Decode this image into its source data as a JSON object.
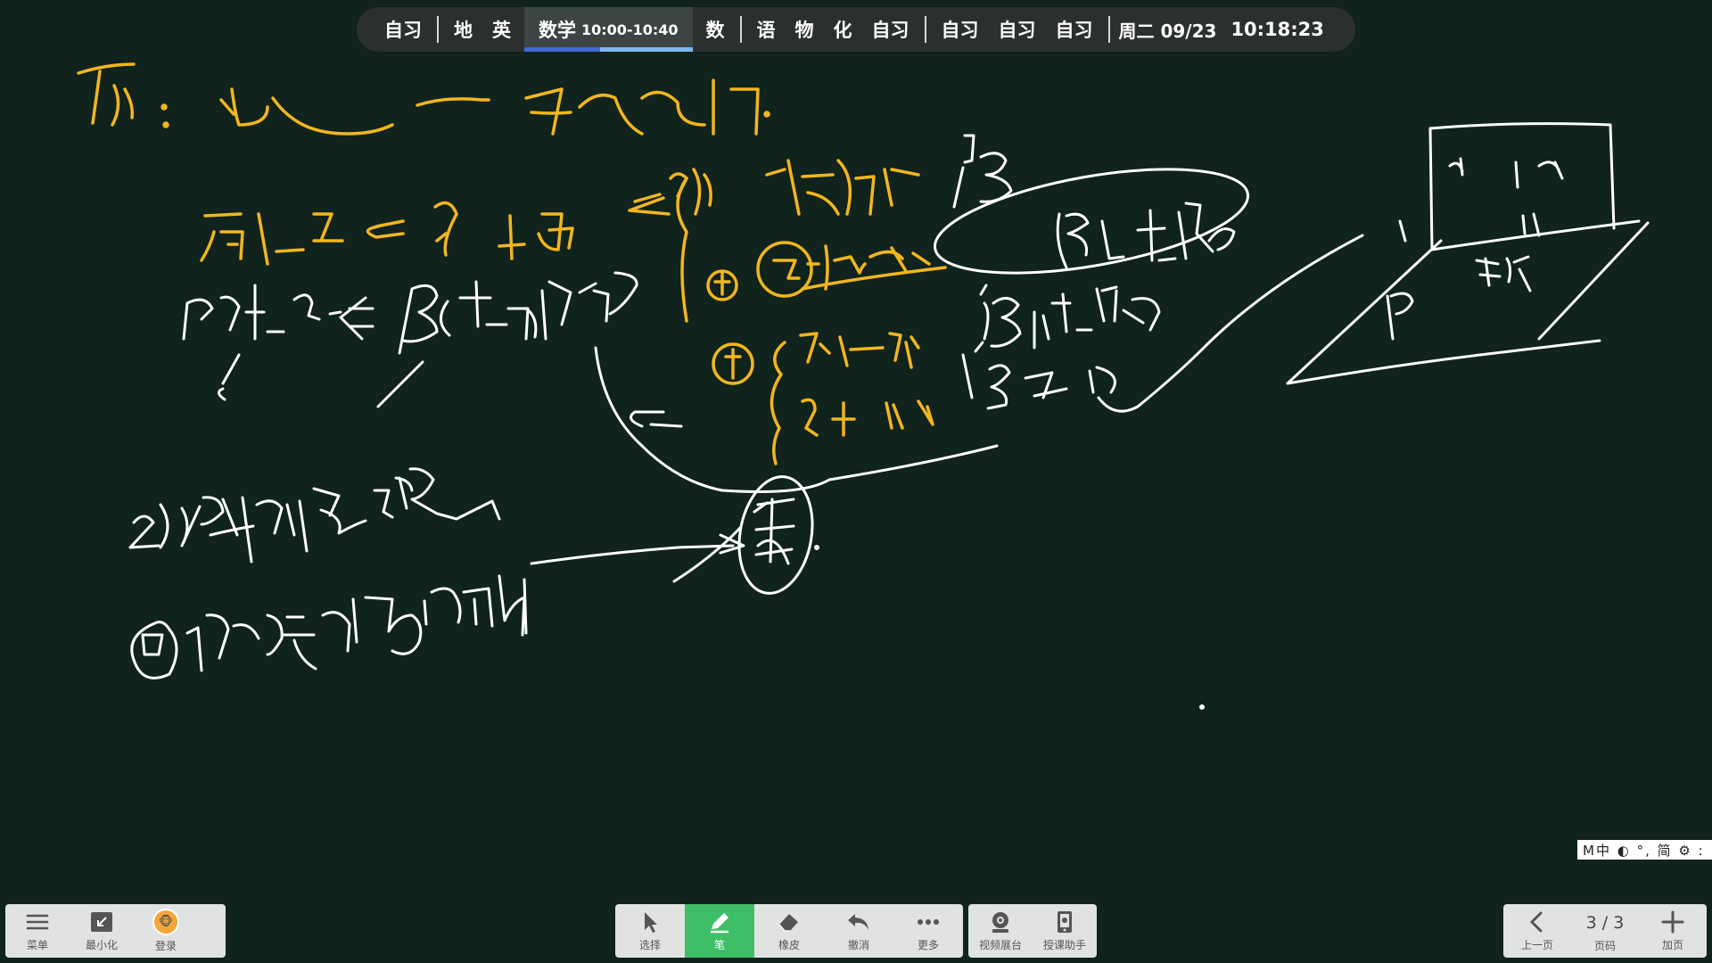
{
  "schedule": {
    "before": [
      "自习",
      "|",
      "地",
      "英"
    ],
    "current": {
      "subject": "数学",
      "time": "10:00-10:40",
      "progress": 0.45
    },
    "after": [
      "数",
      "|",
      "语",
      "物",
      "化",
      "自习",
      "|",
      "自习",
      "自习",
      "自习",
      "|"
    ],
    "day": "周二 09/23",
    "clock": "10:18:23"
  },
  "ime_bar": {
    "text": "M中 ◐ °, 简 ⚙ :"
  },
  "colors": {
    "board": "#10231d",
    "chalk_white": "#ffffff",
    "chalk_yellow": "#f2b61e",
    "active_tool": "#3fbe68"
  },
  "toolbar_left": [
    {
      "label": "菜单",
      "icon": "menu-icon"
    },
    {
      "label": "最小化",
      "icon": "minimize-icon"
    },
    {
      "label": "登录",
      "icon": "avatar-icon"
    }
  ],
  "toolbar_center": [
    {
      "label": "选择",
      "icon": "cursor-icon"
    },
    {
      "label": "笔",
      "icon": "pen-icon",
      "active": true
    },
    {
      "label": "橡皮",
      "icon": "eraser-icon"
    },
    {
      "label": "撤消",
      "icon": "undo-icon"
    },
    {
      "label": "更多",
      "icon": "more-icon"
    }
  ],
  "toolbar_center2": [
    {
      "label": "视频展台",
      "icon": "camera-icon"
    },
    {
      "label": "授课助手",
      "icon": "assistant-icon"
    }
  ],
  "toolbar_right": {
    "prev_label": "上一页",
    "page_text": "3 / 3",
    "page_label": "页码",
    "add_label": "加页"
  }
}
